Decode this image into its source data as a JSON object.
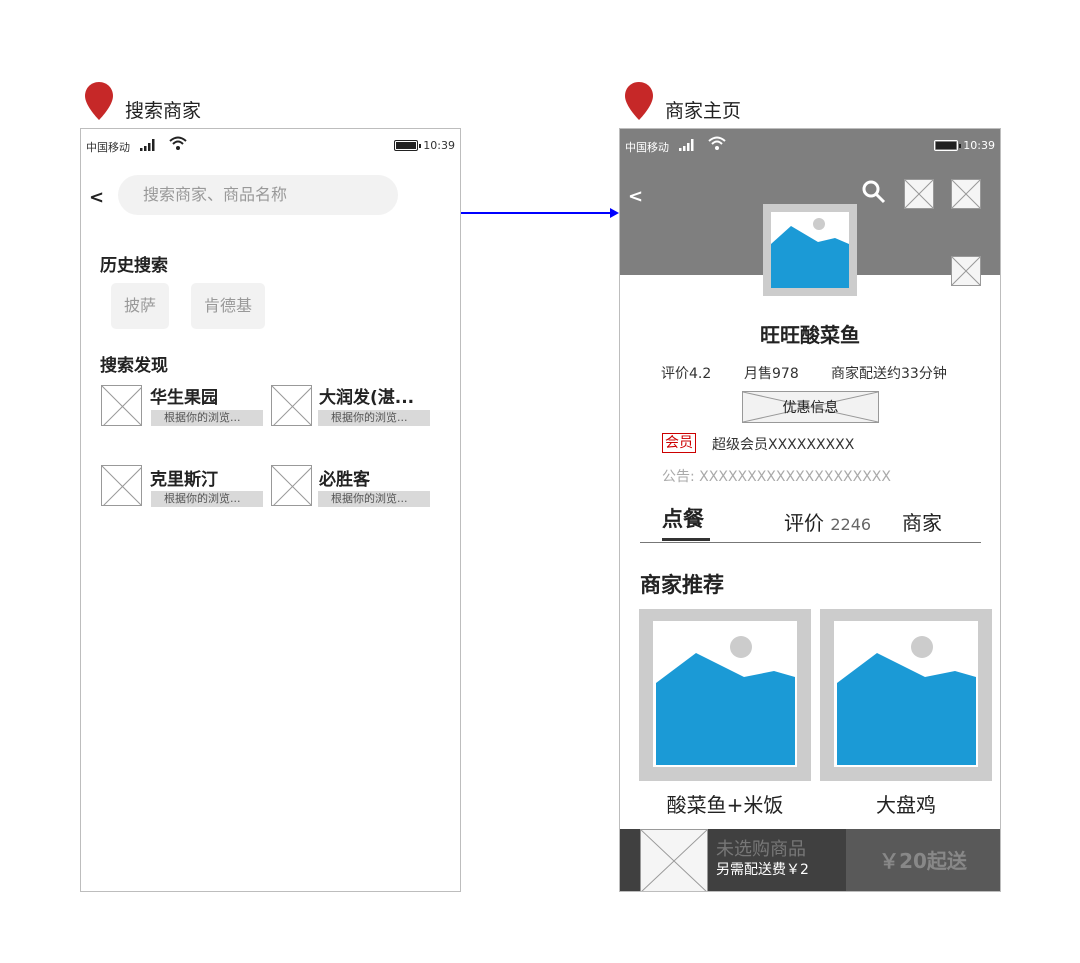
{
  "screens": {
    "search": {
      "label": "搜索商家"
    },
    "store": {
      "label": "商家主页"
    }
  },
  "status_bar": {
    "carrier": "中国移动",
    "time": "10:39"
  },
  "search_screen": {
    "back_label": "<",
    "search_placeholder": "搜索商家、商品名称",
    "history_title": "历史搜索",
    "history_items": [
      "披萨",
      "肯德基"
    ],
    "discover_title": "搜索发现",
    "discover_items": [
      {
        "name": "华生果园",
        "desc": "根据你的浏览..."
      },
      {
        "name": "大润发(湛...",
        "desc": "根据你的浏览..."
      },
      {
        "name": "克里斯汀",
        "desc": "根据你的浏览..."
      },
      {
        "name": "必胜客",
        "desc": "根据你的浏览..."
      }
    ]
  },
  "store_screen": {
    "back_label": "<",
    "name": "旺旺酸菜鱼",
    "rating": "评价4.2",
    "monthly_sales": "月售978",
    "delivery_time": "商家配送约33分钟",
    "promo_label": "优惠信息",
    "member_badge": "会员",
    "member_text": "超级会员XXXXXXXXX",
    "notice": "公告: XXXXXXXXXXXXXXXXXXXX",
    "tabs": {
      "order": "点餐",
      "reviews": "评价",
      "reviews_count": "2246",
      "merchant": "商家"
    },
    "recommend_title": "商家推荐",
    "dishes": [
      {
        "name": "酸菜鱼+米饭"
      },
      {
        "name": "大盘鸡"
      }
    ],
    "cart": {
      "status": "未选购商品",
      "fee": "另需配送费￥2",
      "min_order": "￥20起送"
    }
  },
  "colors": {
    "pin": "#c62828",
    "arrow": "#0000ff",
    "image_blue": "#1b9ad6",
    "header_grey": "#7f7f7f"
  }
}
